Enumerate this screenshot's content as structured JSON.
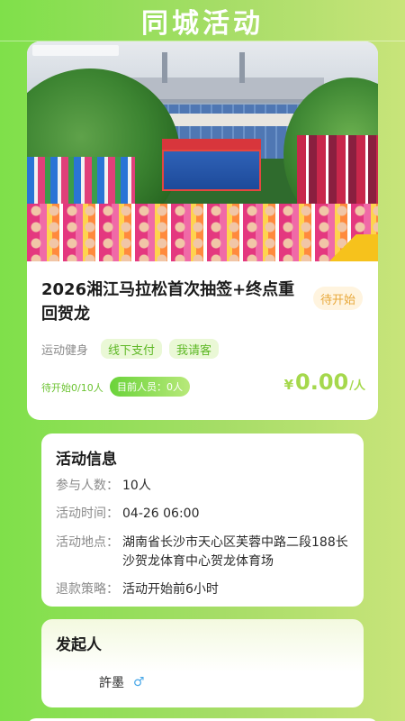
{
  "header": {
    "title": "同城活动"
  },
  "event": {
    "title": "2026湘江马拉松首次抽签+终点重回贺龙",
    "status": "待开始",
    "category_label": "运动健身",
    "tags": [
      "线下支付",
      "我请客"
    ],
    "progress_text": "待开始0/10人",
    "people_badge": "目前人员：0人",
    "price_symbol": "¥",
    "price_value": "0.00",
    "price_unit": "/人",
    "hero_image": "marathon-crowd-photo"
  },
  "activity_info": {
    "title": "活动信息",
    "rows": [
      {
        "label": "参与人数：",
        "value": "10人"
      },
      {
        "label": "活动时间：",
        "value": "04-26 06:00"
      },
      {
        "label": "活动地点：",
        "value": "湖南省长沙市天心区芙蓉中路二段188长沙贺龙体育中心贺龙体育场"
      },
      {
        "label": "退款策略：",
        "value": "活动开始前6小时"
      }
    ]
  },
  "organizer": {
    "title": "发起人",
    "name": "許墨",
    "gender_icon": "male-icon",
    "gender_symbol": "♂"
  },
  "colors": {
    "accent_green": "#6cc332",
    "price_green": "#a5d84c",
    "status_orange": "#e8a83a"
  }
}
